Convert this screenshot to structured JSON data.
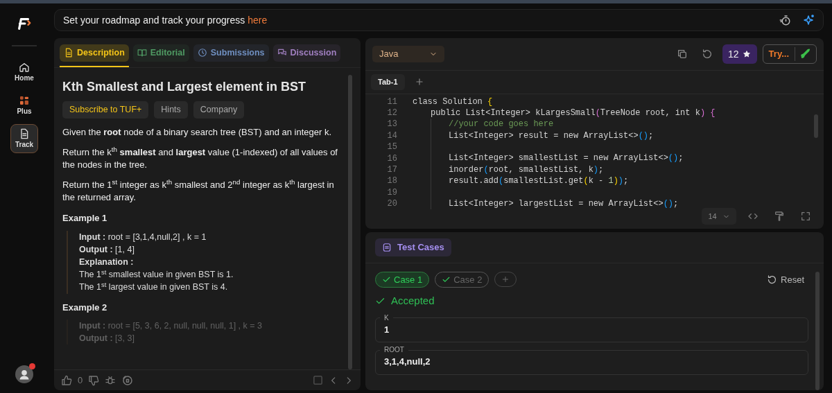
{
  "sidebar": {
    "items": [
      {
        "label": "Home",
        "selected": false
      },
      {
        "label": "Plus",
        "selected": false
      },
      {
        "label": "Track",
        "selected": true
      }
    ],
    "avatar": {
      "notification": true
    }
  },
  "banner": {
    "text": "Set your roadmap and track your progress",
    "link": "here"
  },
  "problem": {
    "tabs": [
      {
        "label": "Description",
        "color": "#f5c518",
        "selected": true
      },
      {
        "label": "Editorial",
        "color": "#4f9a63",
        "selected": false
      },
      {
        "label": "Submissions",
        "color": "#6f8fc0",
        "selected": false
      },
      {
        "label": "Discussion",
        "color": "#a07fc0",
        "selected": false
      }
    ],
    "title": "Kth Smallest and Largest element in BST",
    "chips": [
      {
        "label": "Subscribe to TUF+",
        "kind": "premium"
      },
      {
        "label": "Hints",
        "kind": "plain"
      },
      {
        "label": "Company",
        "kind": "plain"
      }
    ],
    "paragraphs": [
      "Given the **root** node of a binary search tree (BST) and an integer k.",
      "Return the k$^{th}$ **smallest** and **largest** value (1-indexed) of all values of the nodes in the tree.",
      "Return the 1$^{st}$ integer as k$^{th}$ smallest and 2$^{nd}$ integer as k$^{th}$ largest in the returned array."
    ],
    "examples": [
      {
        "title": "Example 1",
        "faded": false,
        "lines": [
          "**Input :** root = [3,1,4,null,2] , k = 1",
          "**Output :** [1, 4]",
          "**Explanation :**",
          "The 1$^{st}$ smallest value in given BST is 1.",
          "The 1$^{st}$ largest value in given BST is 4."
        ]
      },
      {
        "title": "Example 2",
        "faded": true,
        "lines": [
          "**Input :** root = [5, 3, 6, 2, null, null, null, 1] , k = 3",
          "**Output :** [3, 3]"
        ]
      }
    ],
    "footer": {
      "likes": "0"
    }
  },
  "editor": {
    "language": "Java",
    "stars": "12",
    "try_label": "Try...",
    "tabs": [
      {
        "label": "Tab-1",
        "selected": true
      }
    ],
    "lines": [
      {
        "n": "11",
        "code": "class Solution {",
        "kind": "code",
        "children": [
          {
            "n": "12",
            "code": "public List<Integer> kLargesSmall(TreeNode root, int k) {",
            "kind": "code",
            "children": [
              {
                "n": "13",
                "code": "//your code goes here",
                "kind": "comment"
              },
              {
                "n": "14",
                "code": "List<Integer> result = new ArrayList<>();",
                "kind": "code"
              },
              {
                "n": "15"
              },
              {
                "n": "16",
                "code": "List<Integer> smallestList = new ArrayList<>();",
                "kind": "code"
              },
              {
                "n": "17",
                "code": "inorder(root, smallestList, k);",
                "kind": "code"
              },
              {
                "n": "18",
                "code": "result.add(smallestList.get(k - 1));",
                "kind": "code"
              },
              {
                "n": "19"
              },
              {
                "n": "20",
                "code": "List<Integer> largestList = new ArrayList<>();",
                "kind": "code"
              }
            ]
          }
        ]
      }
    ],
    "font_size": "14"
  },
  "testcases": {
    "title": "Test Cases",
    "cases": [
      {
        "label": "Case 1",
        "selected": true,
        "passed": true
      },
      {
        "label": "Case 2",
        "selected": false,
        "passed": true
      }
    ],
    "reset": "Reset",
    "status": {
      "text": "Accepted",
      "kind": "accepted"
    },
    "fields": [
      {
        "label": "K",
        "value": "1"
      },
      {
        "label": "ROOT",
        "value": "3,1,4,null,2"
      }
    ]
  }
}
